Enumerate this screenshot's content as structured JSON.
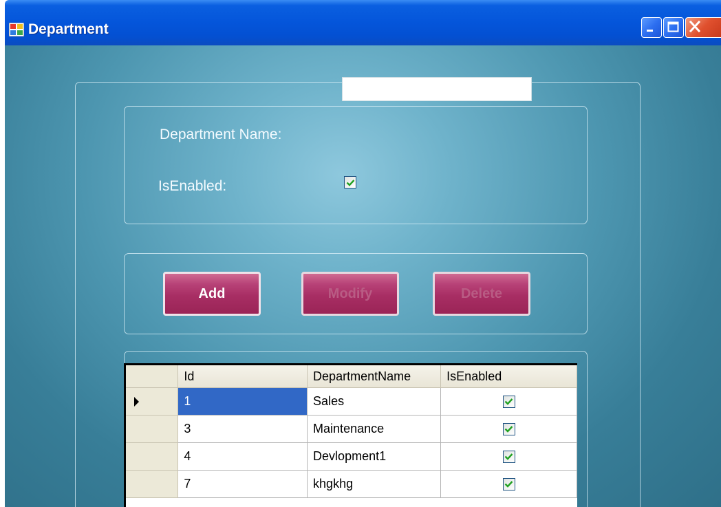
{
  "window": {
    "title": "Department"
  },
  "form": {
    "department_name_label": "Department Name:",
    "department_name_value": "",
    "is_enabled_label": "IsEnabled:",
    "is_enabled_checked": true
  },
  "buttons": {
    "add": "Add",
    "modify": "Modify",
    "delete": "Delete"
  },
  "grid": {
    "columns": [
      "Id",
      "DepartmentName",
      "IsEnabled"
    ],
    "rows": [
      {
        "id": "1",
        "name": "Sales",
        "enabled": true,
        "selected": true
      },
      {
        "id": "3",
        "name": "Maintenance",
        "enabled": true
      },
      {
        "id": "4",
        "name": "Devlopment1",
        "enabled": true
      },
      {
        "id": "7",
        "name": "khgkhg",
        "enabled": true
      }
    ]
  },
  "colors": {
    "titlebar": "#0455da",
    "button": "#a82e64",
    "selection": "#3168c6"
  }
}
